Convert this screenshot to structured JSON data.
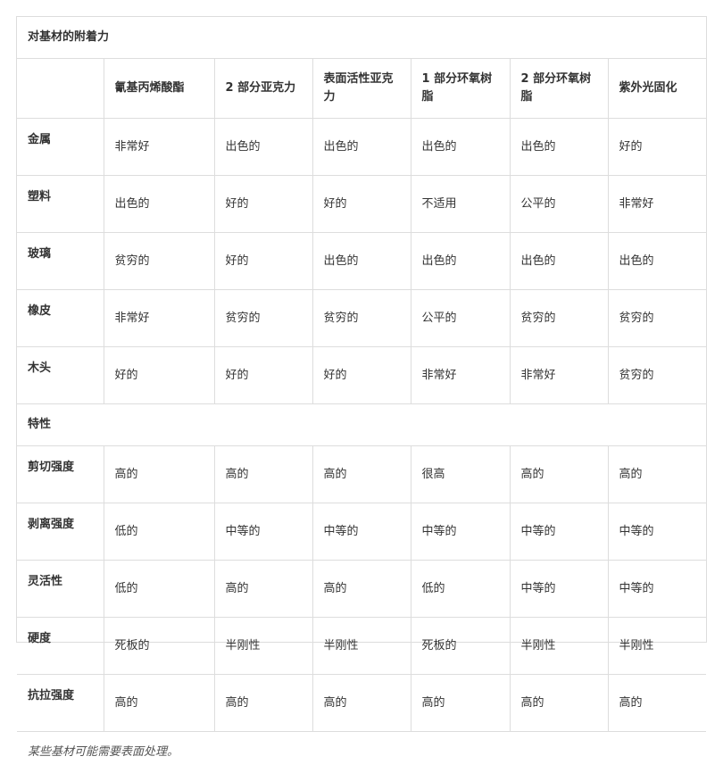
{
  "table": {
    "caption": "对基材的附着力",
    "columns": [
      "",
      "氰基丙烯酸酯",
      "2 部分亚克力",
      "表面活性亚克力",
      "1 部分环氧树脂",
      "2 部分环氧树脂",
      "紫外光固化"
    ],
    "adhesion_rows": [
      {
        "label": "金属",
        "values": [
          "非常好",
          "出色的",
          "出色的",
          "出色的",
          "出色的",
          "好的"
        ]
      },
      {
        "label": "塑料",
        "values": [
          "出色的",
          "好的",
          "好的",
          "不适用",
          "公平的",
          "非常好"
        ]
      },
      {
        "label": "玻璃",
        "values": [
          "贫穷的",
          "好的",
          "出色的",
          "出色的",
          "出色的",
          "出色的"
        ]
      },
      {
        "label": "橡皮",
        "values": [
          "非常好",
          "贫穷的",
          "贫穷的",
          "公平的",
          "贫穷的",
          "贫穷的"
        ]
      },
      {
        "label": "木头",
        "values": [
          "好的",
          "好的",
          "好的",
          "非常好",
          "非常好",
          "贫穷的"
        ]
      }
    ],
    "properties_heading": "特性",
    "property_rows": [
      {
        "label": "剪切强度",
        "values": [
          "高的",
          "高的",
          "高的",
          "很高",
          "高的",
          "高的"
        ]
      },
      {
        "label": "剥离强度",
        "values": [
          "低的",
          "中等的",
          "中等的",
          "中等的",
          "中等的",
          "中等的"
        ]
      },
      {
        "label": "灵活性",
        "values": [
          "低的",
          "高的",
          "高的",
          "低的",
          "中等的",
          "中等的"
        ]
      },
      {
        "label": "硬度",
        "values": [
          "死板的",
          "半刚性",
          "半刚性",
          "死板的",
          "半刚性",
          "半刚性"
        ]
      },
      {
        "label": "抗拉强度",
        "values": [
          "高的",
          "高的",
          "高的",
          "高的",
          "高的",
          "高的"
        ]
      }
    ],
    "footnote": "某些基材可能需要表面处理。"
  }
}
